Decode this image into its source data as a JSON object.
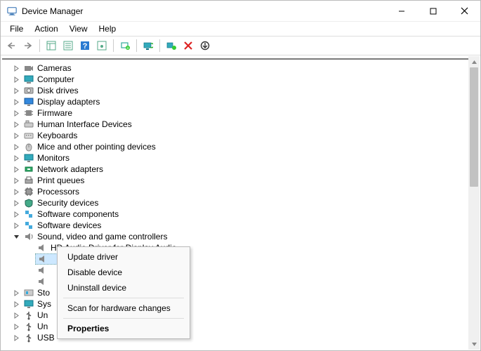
{
  "window": {
    "title": "Device Manager"
  },
  "menu": {
    "file": "File",
    "action": "Action",
    "view": "View",
    "help": "Help"
  },
  "tree": {
    "cameras": "Cameras",
    "computer": "Computer",
    "disk": "Disk drives",
    "display": "Display adapters",
    "firmware": "Firmware",
    "hid": "Human Interface Devices",
    "keyboards": "Keyboards",
    "mice": "Mice and other pointing devices",
    "monitors": "Monitors",
    "network": "Network adapters",
    "print": "Print queues",
    "processors": "Processors",
    "security": "Security devices",
    "swcomp": "Software components",
    "swdev": "Software devices",
    "sound": "Sound, video and game controllers",
    "sound_children": {
      "hdaudio": "HD Audio Driver for Display Audio"
    },
    "storage": "Sto",
    "system": "Sys",
    "un1": "Un",
    "un2": "Un",
    "usb": "USB"
  },
  "context_menu": {
    "update": "Update driver",
    "disable": "Disable device",
    "uninstall": "Uninstall device",
    "scan": "Scan for hardware changes",
    "properties": "Properties"
  }
}
